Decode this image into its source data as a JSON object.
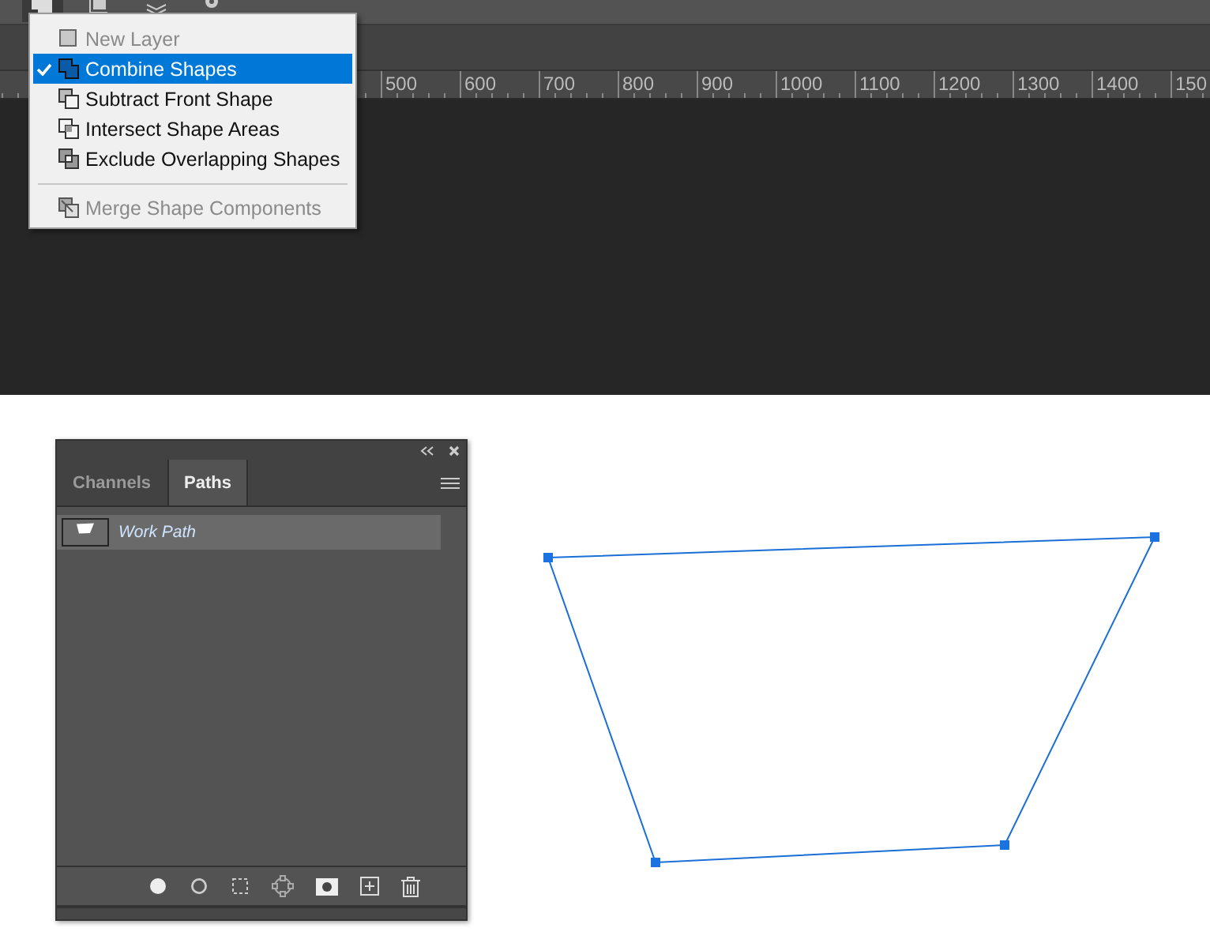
{
  "ruler": {
    "labels": [
      "500",
      "600",
      "700",
      "800",
      "900",
      "1000",
      "1100",
      "1200",
      "1300",
      "1400",
      "150"
    ]
  },
  "shape_menu": {
    "items": [
      {
        "kind": "item",
        "label": "New Layer",
        "checked": false,
        "selected": false,
        "disabled": true
      },
      {
        "kind": "item",
        "label": "Combine Shapes",
        "checked": true,
        "selected": true,
        "disabled": false
      },
      {
        "kind": "item",
        "label": "Subtract Front Shape",
        "checked": false,
        "selected": false,
        "disabled": false
      },
      {
        "kind": "item",
        "label": "Intersect Shape Areas",
        "checked": false,
        "selected": false,
        "disabled": false
      },
      {
        "kind": "item",
        "label": "Exclude Overlapping Shapes",
        "checked": false,
        "selected": false,
        "disabled": false
      },
      {
        "kind": "separator"
      },
      {
        "kind": "item",
        "label": "Merge Shape Components",
        "checked": false,
        "selected": false,
        "disabled": true
      }
    ]
  },
  "panel": {
    "tabs": [
      {
        "label": "Channels",
        "selected": false
      },
      {
        "label": "Paths",
        "selected": true
      }
    ],
    "paths": [
      {
        "name": "Work Path",
        "selected": true
      }
    ]
  }
}
